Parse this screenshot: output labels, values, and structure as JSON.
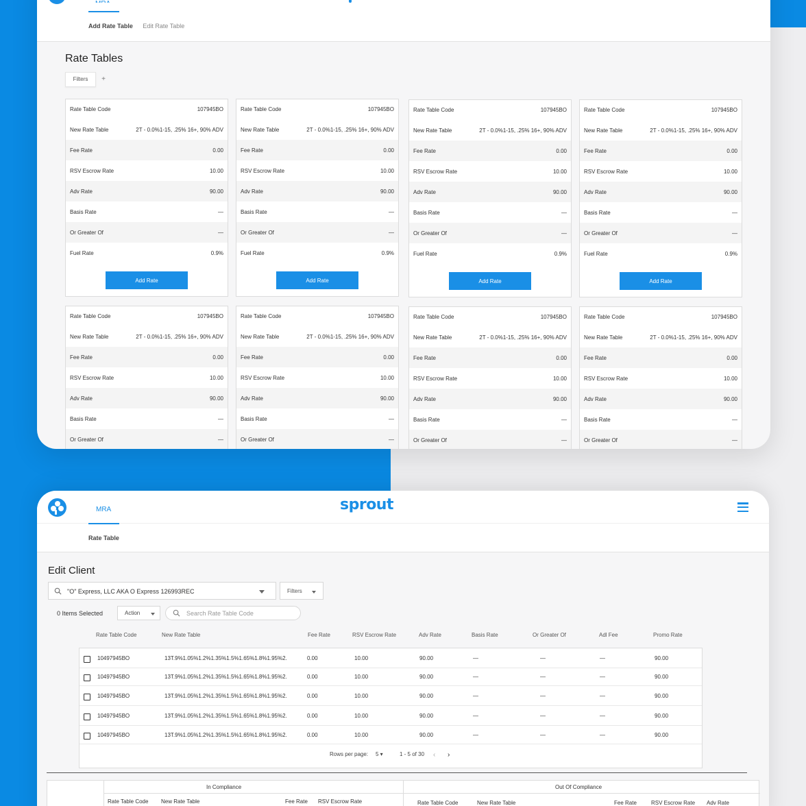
{
  "colors": {
    "accent": "#1a8fe6",
    "background_blue": "#0a8ae3"
  },
  "panel_top": {
    "nav_tab": "MRA",
    "subtabs": [
      "Add Rate Table",
      "Edit Rate Table"
    ],
    "title": "Rate Tables",
    "filters_label": "Filters",
    "plus_label": "+",
    "card": {
      "rows": [
        {
          "label": "Rate Table Code",
          "value": "107945BO"
        },
        {
          "label": "New Rate Table",
          "value": "2T - 0.0%1-15, .25% 16+, 90% ADV"
        },
        {
          "label": "Fee Rate",
          "value": "0.00"
        },
        {
          "label": "RSV Escrow Rate",
          "value": "10.00"
        },
        {
          "label": "Adv Rate",
          "value": "90.00"
        },
        {
          "label": "Basis Rate",
          "value": "—"
        },
        {
          "label": "Or Greater Of",
          "value": "—"
        },
        {
          "label": "Fuel Rate",
          "value": "0.9%"
        }
      ],
      "button_label": "Add Rate"
    }
  },
  "panel_bottom": {
    "nav_tab": "MRA",
    "brand": "sprout",
    "subtab": "Rate Table",
    "title": "Edit Client",
    "client_select_value": "\"O\" Express, LLC AKA O Express 126993REC",
    "filters_label": "Filters",
    "items_selected": "0 Items Selected",
    "action_label": "Action",
    "search_placeholder": "Search Rate Table Code",
    "columns": [
      "Rate Table Code",
      "New Rate Table",
      "Fee Rate",
      "RSV Escrow Rate",
      "Adv Rate",
      "Basis Rate",
      "Or Greater Of",
      "Adl Fee",
      "Promo Rate"
    ],
    "rows": [
      [
        "10497945BO",
        "13T.9%1.05%1.2%1.35%1.5%1.65%1.8%1.95%2.",
        "0.00",
        "10.00",
        "90.00",
        "—",
        "—",
        "—",
        "90.00"
      ],
      [
        "10497945BO",
        "13T.9%1.05%1.2%1.35%1.5%1.65%1.8%1.95%2.",
        "0.00",
        "10.00",
        "90.00",
        "—",
        "—",
        "—",
        "90.00"
      ],
      [
        "10497945BO",
        "13T.9%1.05%1.2%1.35%1.5%1.65%1.8%1.95%2.",
        "0.00",
        "10.00",
        "90.00",
        "—",
        "—",
        "—",
        "90.00"
      ],
      [
        "10497945BO",
        "13T.9%1.05%1.2%1.35%1.5%1.65%1.8%1.95%2.",
        "0.00",
        "10.00",
        "90.00",
        "—",
        "—",
        "—",
        "90.00"
      ],
      [
        "10497945BO",
        "13T.9%1.05%1.2%1.35%1.5%1.65%1.8%1.95%2.",
        "0.00",
        "10.00",
        "90.00",
        "—",
        "—",
        "—",
        "90.00"
      ]
    ],
    "rows_per_page_label": "Rows per page:",
    "rows_per_page_value": "5",
    "page_range": "1 - 5 of 30",
    "in_compliance": {
      "title": "In Compliance",
      "columns": [
        "Rate Table Code",
        "New Rate Table",
        "Fee Rate",
        "RSV Escrow Rate"
      ]
    },
    "out_of_compliance": {
      "title": "Out Of Compliance",
      "columns": [
        "Rate Table Code",
        "New Rate Table",
        "Fee Rate",
        "RSV Escrow Rate",
        "Adv Rate"
      ]
    }
  }
}
